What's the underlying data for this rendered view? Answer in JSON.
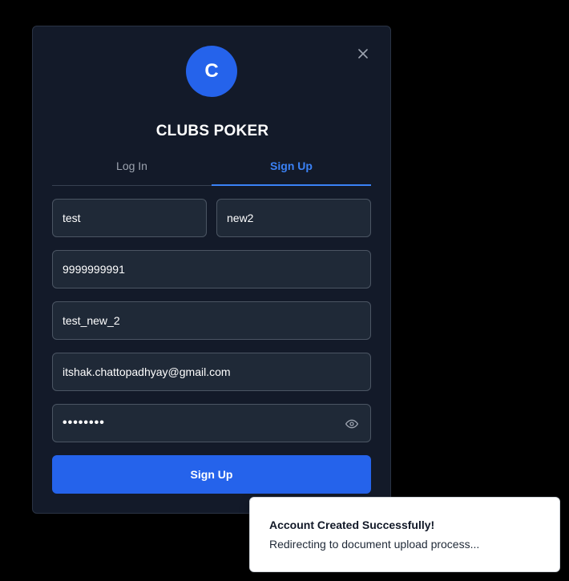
{
  "modal": {
    "logo_letter": "C",
    "brand": "CLUBS POKER",
    "close_icon": "close-icon"
  },
  "tabs": [
    {
      "label": "Log In",
      "active": false
    },
    {
      "label": "Sign Up",
      "active": true
    }
  ],
  "form": {
    "first_name": "test",
    "last_name": "new2",
    "phone": "9999999991",
    "username": "test_new_2",
    "email": "itshak.chattopadhyay@gmail.com",
    "password_masked": "••••••••",
    "password_toggle_icon": "eye-icon",
    "submit_label": "Sign Up"
  },
  "toast": {
    "title": "Account Created Successfully!",
    "message": "Redirecting to document upload process..."
  },
  "colors": {
    "accent": "#2563eb",
    "modal_bg": "#131a29",
    "field_bg": "#1f2937"
  }
}
